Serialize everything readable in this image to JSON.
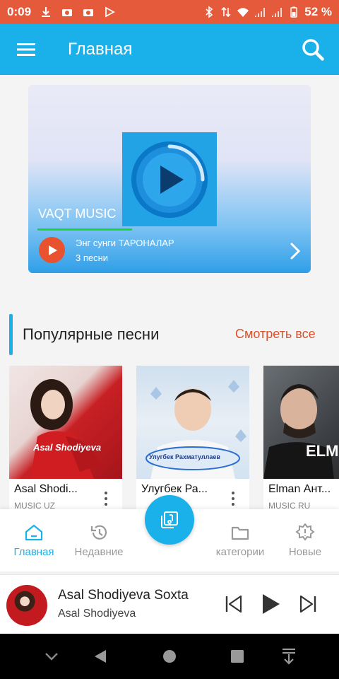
{
  "status": {
    "time": "0:09",
    "battery": "52 %"
  },
  "header": {
    "title": "Главная"
  },
  "banner": {
    "label": "VAQT MUSIC",
    "playlist_title": "Энг сунги ТАРОНАЛАР",
    "playlist_count": "3 песни"
  },
  "section": {
    "title": "Популярные песни",
    "see_all": "Смотреть все"
  },
  "songs": [
    {
      "name": "Asal Shodi...",
      "tag": "MUSIC UZ",
      "watermark": "Asal Shodiyeva"
    },
    {
      "name": "Улугбек Ра...",
      "tag": "",
      "watermark": "Улугбек Рахматуллаев"
    },
    {
      "name": "Elman Ант...",
      "tag": "MUSIC RU",
      "watermark": "ELMA"
    }
  ],
  "nav": {
    "items": [
      {
        "label": "Главная"
      },
      {
        "label": "Недавние"
      },
      {
        "label": "категории"
      },
      {
        "label": "Новые"
      }
    ]
  },
  "player": {
    "title": "Asal Shodiyeva Soxta",
    "artist": "Asal Shodiyeva"
  },
  "colors": {
    "accent": "#1ab1ea",
    "status_bar": "#e45a3a",
    "see_all": "#d9532f",
    "progress": "#1fd33a"
  }
}
